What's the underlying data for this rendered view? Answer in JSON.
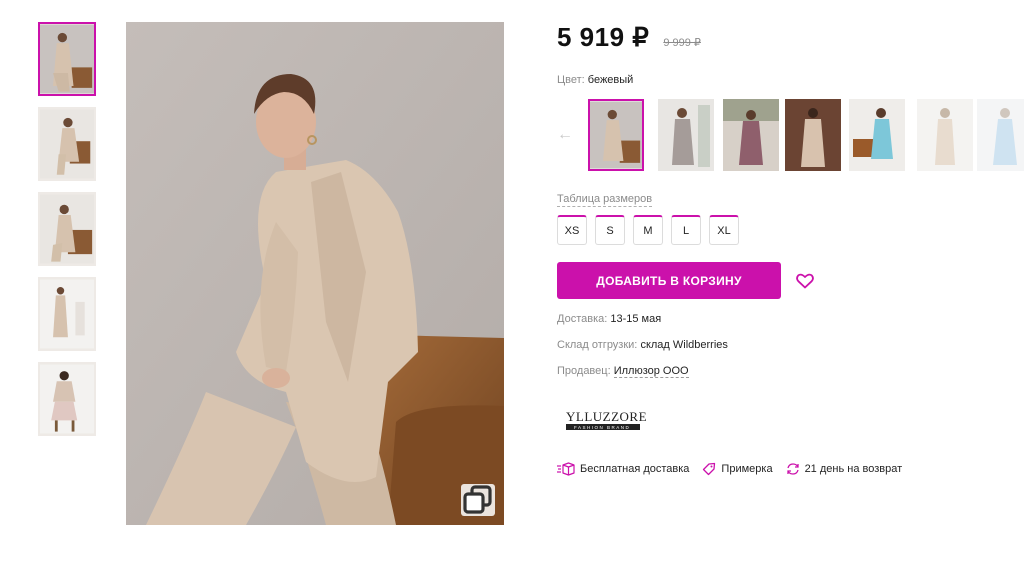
{
  "product": {
    "price": "5 919 ₽",
    "old_price": "9 999 ₽",
    "color_label": "Цвет:",
    "color_value": "бежевый",
    "size_table_label": "Таблица размеров",
    "sizes": [
      "XS",
      "S",
      "M",
      "L",
      "XL"
    ],
    "add_to_cart_label": "ДОБАВИТЬ В КОРЗИНУ",
    "delivery_label": "Доставка:",
    "delivery_value": "13-15 мая",
    "warehouse_label": "Склад отгрузки:",
    "warehouse_value": "склад Wildberries",
    "seller_label": "Продавец:",
    "seller_value": "Иллюзор ООО",
    "brand_name": "YLLUZZORE",
    "brand_tagline": "FASHION BRAND"
  },
  "features": [
    {
      "icon": "box-icon",
      "label": "Бесплатная доставка"
    },
    {
      "icon": "tag-icon",
      "label": "Примерка"
    },
    {
      "icon": "return-icon",
      "label": "21 день на возврат"
    }
  ],
  "colors": {
    "accent": "#cb11ab",
    "text": "#242424",
    "muted": "#8b8b8b",
    "coat": "#d6c2ae"
  },
  "thumbnails": [
    {
      "name": "photo-1",
      "active": true
    },
    {
      "name": "photo-2",
      "active": false
    },
    {
      "name": "photo-3",
      "active": false
    },
    {
      "name": "photo-4",
      "active": false
    },
    {
      "name": "photo-5",
      "active": false
    }
  ],
  "color_options": [
    {
      "name": "beige",
      "active": true
    },
    {
      "name": "grey",
      "active": false
    },
    {
      "name": "mauve",
      "active": false
    },
    {
      "name": "brown-beige",
      "active": false
    },
    {
      "name": "light-blue",
      "active": false
    },
    {
      "name": "light-beige",
      "active": false
    },
    {
      "name": "white-blue",
      "active": false
    }
  ]
}
